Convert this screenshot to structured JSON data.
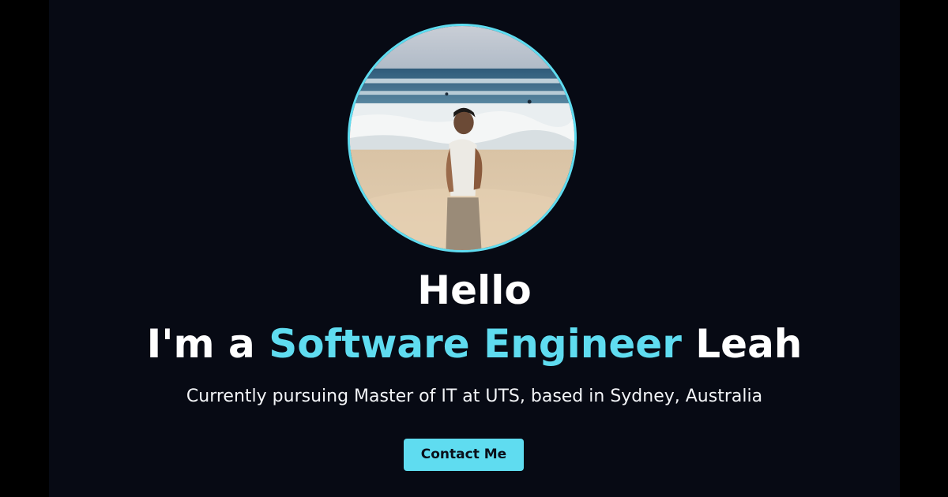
{
  "hero": {
    "greeting": "Hello",
    "headline_prefix": "I'm a",
    "headline_role": "Software Engineer",
    "headline_name": "Leah",
    "subtitle": "Currently pursuing Master of IT at UTS, based in Sydney, Australia",
    "contact_label": "Contact Me"
  },
  "avatar": {
    "icon": "profile-photo",
    "description_alt": "Profile photo"
  },
  "colors": {
    "background": "#070a14",
    "page_side": "#000000",
    "accent": "#5fdcf0",
    "text": "#ffffff",
    "button_text": "#0a0f1a"
  }
}
